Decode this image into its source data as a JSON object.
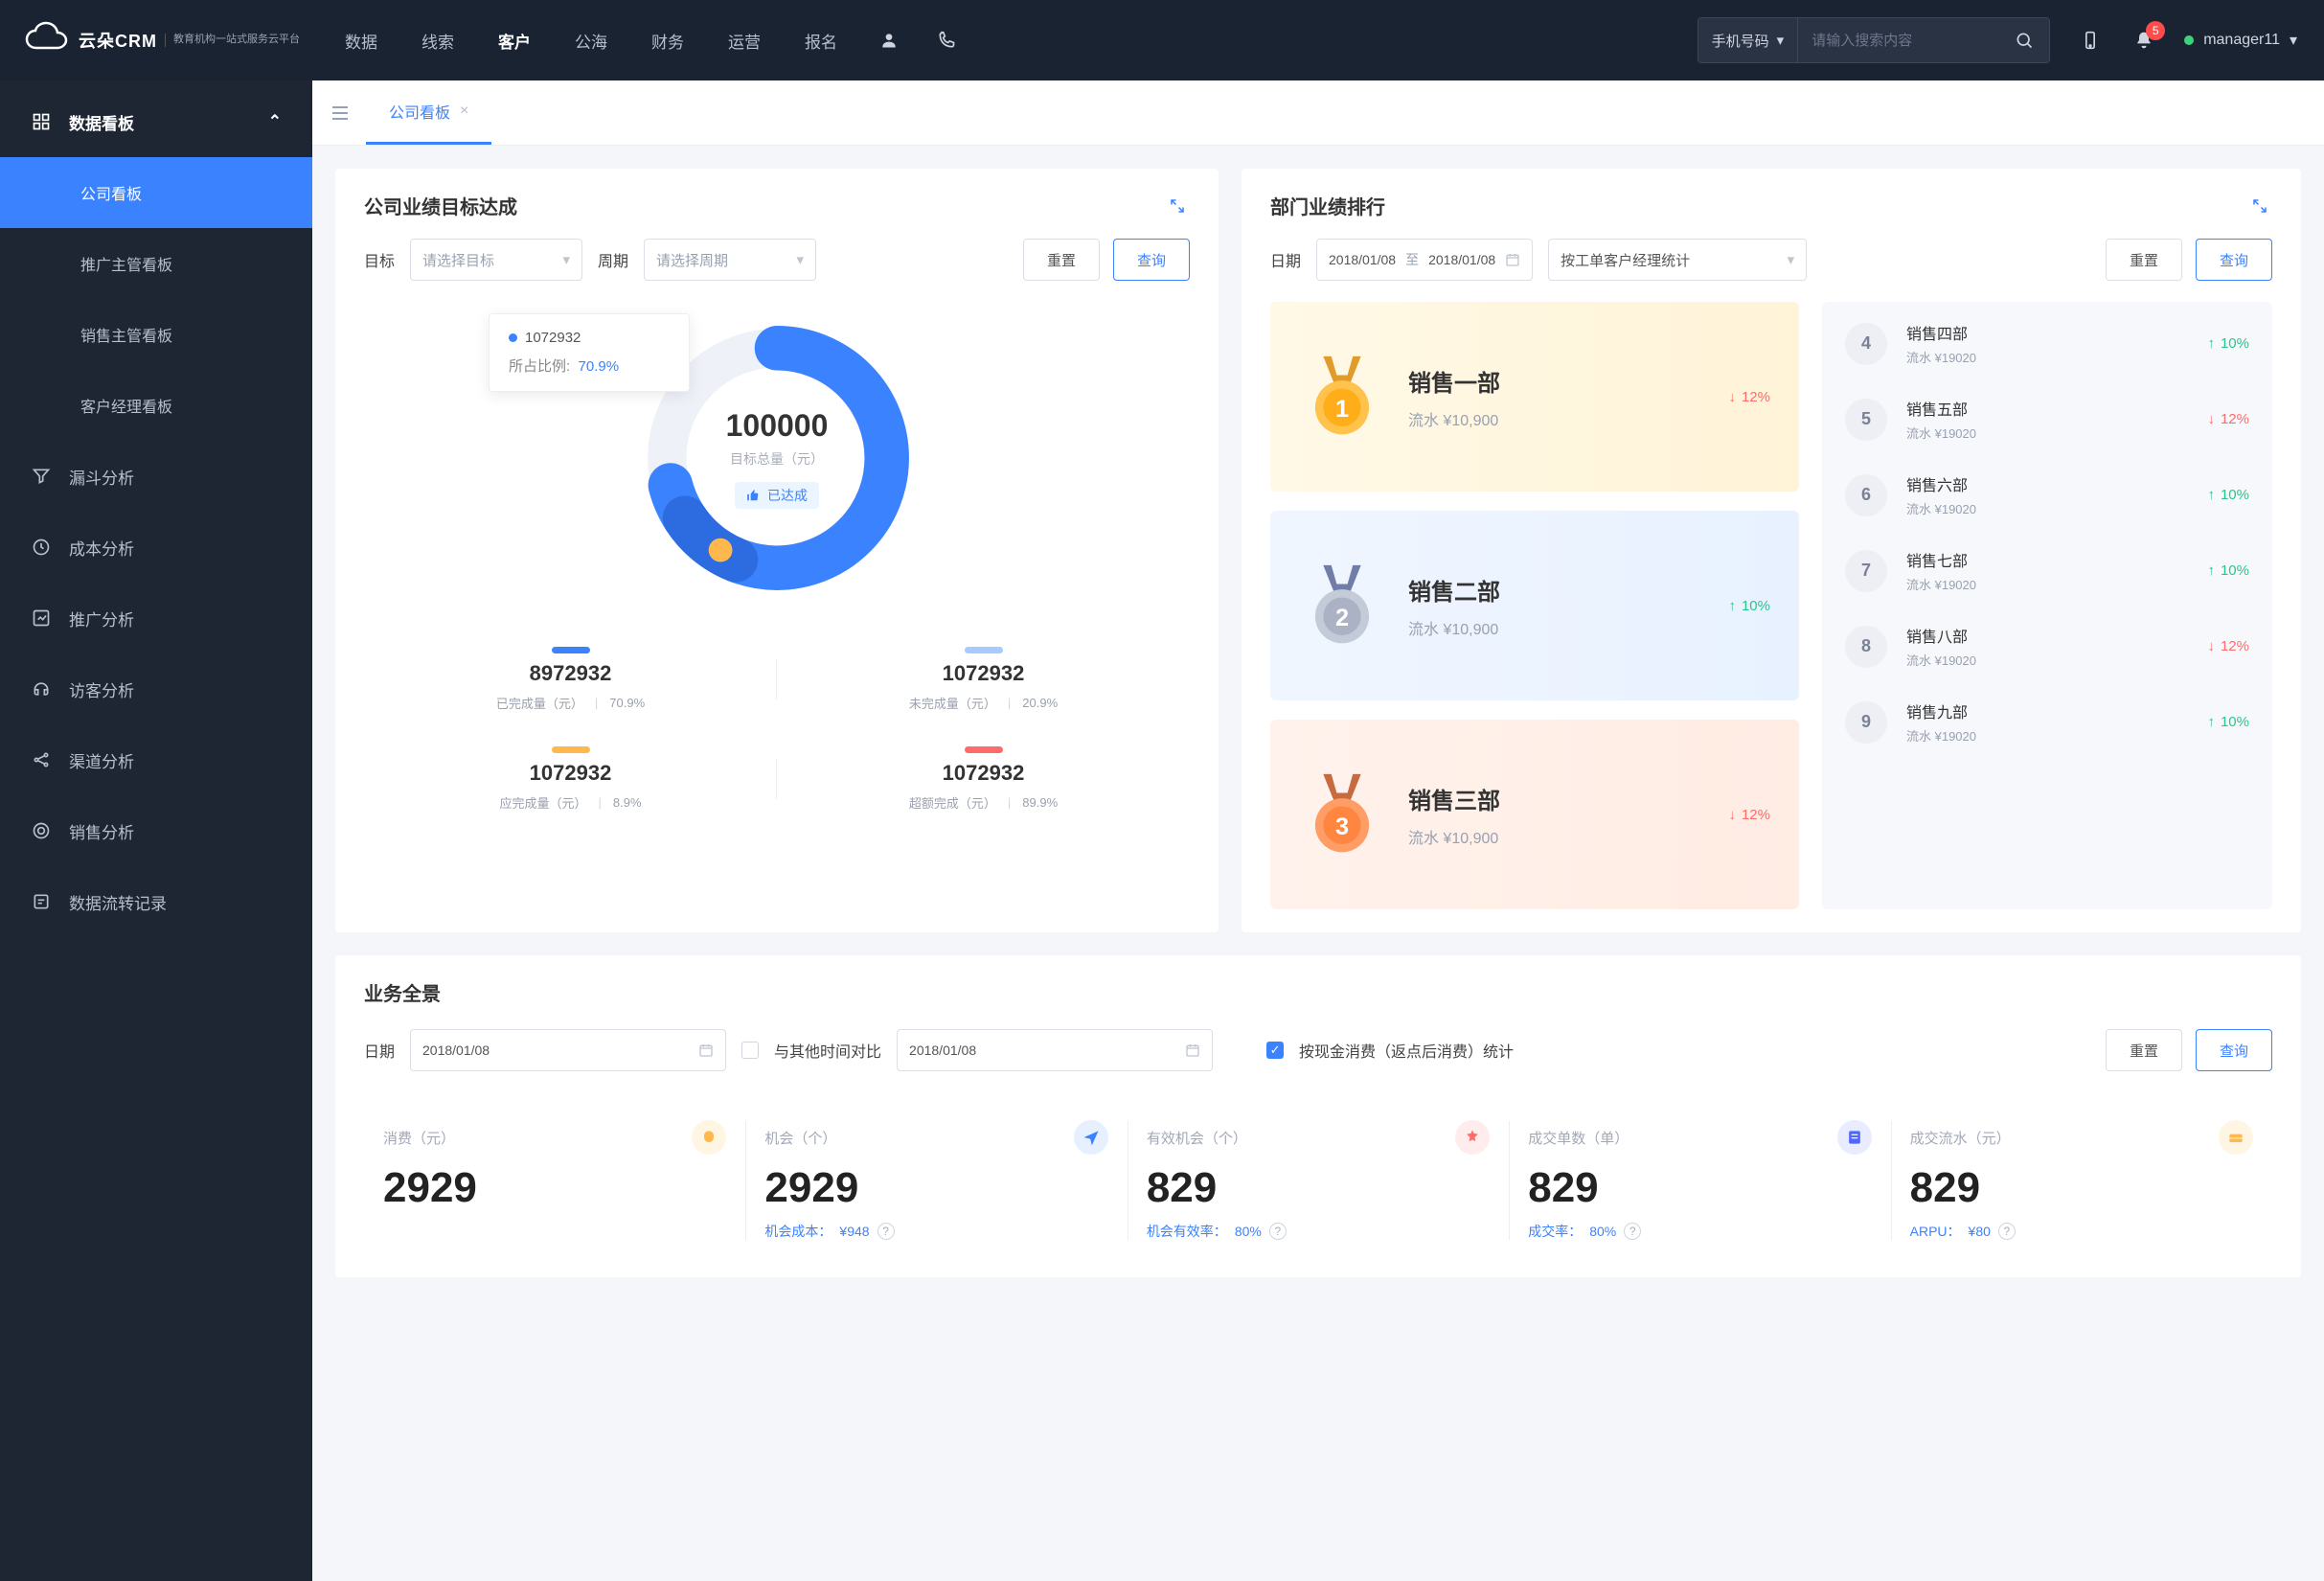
{
  "header": {
    "logo_text": "云朵CRM",
    "logo_subtitle": "教育机构一站式服务云平台",
    "nav": [
      "数据",
      "线索",
      "客户",
      "公海",
      "财务",
      "运营",
      "报名"
    ],
    "nav_active_index": 2,
    "search_type": "手机号码",
    "search_placeholder": "请输入搜索内容",
    "badge_count": "5",
    "username": "manager11"
  },
  "sidebar": {
    "group_title": "数据看板",
    "subs": [
      "公司看板",
      "推广主管看板",
      "销售主管看板",
      "客户经理看板"
    ],
    "active_sub_index": 0,
    "items": [
      {
        "label": "漏斗分析"
      },
      {
        "label": "成本分析"
      },
      {
        "label": "推广分析"
      },
      {
        "label": "访客分析"
      },
      {
        "label": "渠道分析"
      },
      {
        "label": "销售分析"
      },
      {
        "label": "数据流转记录"
      }
    ]
  },
  "tab": {
    "title": "公司看板"
  },
  "goal": {
    "title": "公司业绩目标达成",
    "filter_target_label": "目标",
    "filter_target_placeholder": "请选择目标",
    "filter_period_label": "周期",
    "filter_period_placeholder": "请选择周期",
    "btn_reset": "重置",
    "btn_query": "查询",
    "tooltip_value": "1072932",
    "tooltip_ratio_label": "所占比例:",
    "tooltip_ratio_value": "70.9%",
    "center_value": "100000",
    "center_label": "目标总量（元）",
    "center_badge": "已达成",
    "stats": [
      {
        "color": "#3b82ff",
        "value": "8972932",
        "label": "已完成量（元）",
        "pct": "70.9%"
      },
      {
        "color": "#a7caff",
        "value": "1072932",
        "label": "未完成量（元）",
        "pct": "20.9%"
      },
      {
        "color": "#ffb84d",
        "value": "1072932",
        "label": "应完成量（元）",
        "pct": "8.9%"
      },
      {
        "color": "#ff6b6b",
        "value": "1072932",
        "label": "超额完成（元）",
        "pct": "89.9%"
      }
    ]
  },
  "chart_data": {
    "type": "pie",
    "title": "公司业绩目标达成",
    "unit": "元",
    "total_label": "目标总量（元）",
    "total": 100000,
    "series": [
      {
        "name": "已完成量（元）",
        "value": 8972932,
        "pct": 70.9,
        "color": "#3b82ff"
      },
      {
        "name": "未完成量（元）",
        "value": 1072932,
        "pct": 20.9,
        "color": "#a7caff"
      },
      {
        "name": "应完成量（元）",
        "value": 1072932,
        "pct": 8.9,
        "color": "#ffb84d"
      },
      {
        "name": "超额完成（元）",
        "value": 1072932,
        "pct": 89.9,
        "color": "#ff6b6b"
      }
    ]
  },
  "ranking": {
    "title": "部门业绩排行",
    "date_label": "日期",
    "date_from": "2018/01/08",
    "date_to": "2018/01/08",
    "date_to_word": "至",
    "mode_placeholder": "按工单客户经理统计",
    "btn_reset": "重置",
    "btn_query": "查询",
    "top3_prefix": "流水",
    "top3": [
      {
        "rank": "1",
        "name": "销售一部",
        "flow": "¥10,900",
        "delta": "12%",
        "dir": "down"
      },
      {
        "rank": "2",
        "name": "销售二部",
        "flow": "¥10,900",
        "delta": "10%",
        "dir": "up"
      },
      {
        "rank": "3",
        "name": "销售三部",
        "flow": "¥10,900",
        "delta": "12%",
        "dir": "down"
      }
    ],
    "rest": [
      {
        "rank": "4",
        "name": "销售四部",
        "flow": "流水 ¥19020",
        "delta": "10%",
        "dir": "up"
      },
      {
        "rank": "5",
        "name": "销售五部",
        "flow": "流水 ¥19020",
        "delta": "12%",
        "dir": "down"
      },
      {
        "rank": "6",
        "name": "销售六部",
        "flow": "流水 ¥19020",
        "delta": "10%",
        "dir": "up"
      },
      {
        "rank": "7",
        "name": "销售七部",
        "flow": "流水 ¥19020",
        "delta": "10%",
        "dir": "up"
      },
      {
        "rank": "8",
        "name": "销售八部",
        "flow": "流水 ¥19020",
        "delta": "12%",
        "dir": "down"
      },
      {
        "rank": "9",
        "name": "销售九部",
        "flow": "流水 ¥19020",
        "delta": "10%",
        "dir": "up"
      }
    ]
  },
  "overview": {
    "title": "业务全景",
    "date_label": "日期",
    "date1": "2018/01/08",
    "compare_label": "与其他时间对比",
    "date2": "2018/01/08",
    "stat_label": "按现金消费（返点后消费）统计",
    "btn_reset": "重置",
    "btn_query": "查询",
    "cells": [
      {
        "label": "消费（元）",
        "value": "2929",
        "meta": "",
        "meta_val": "",
        "icon": "#ffb84d",
        "icon_bg": "#fff5e3"
      },
      {
        "label": "机会（个）",
        "value": "2929",
        "meta": "机会成本：",
        "meta_val": "¥948",
        "icon": "#3b82ff",
        "icon_bg": "#e7f0ff"
      },
      {
        "label": "有效机会（个）",
        "value": "829",
        "meta": "机会有效率：",
        "meta_val": "80%",
        "icon": "#ff6b6b",
        "icon_bg": "#ffecec"
      },
      {
        "label": "成交单数（单）",
        "value": "829",
        "meta": "成交率：",
        "meta_val": "80%",
        "icon": "#4f66ff",
        "icon_bg": "#e9ecff"
      },
      {
        "label": "成交流水（元）",
        "value": "829",
        "meta": "ARPU：",
        "meta_val": "¥80",
        "icon": "#ffb84d",
        "icon_bg": "#fff5e3"
      }
    ]
  }
}
